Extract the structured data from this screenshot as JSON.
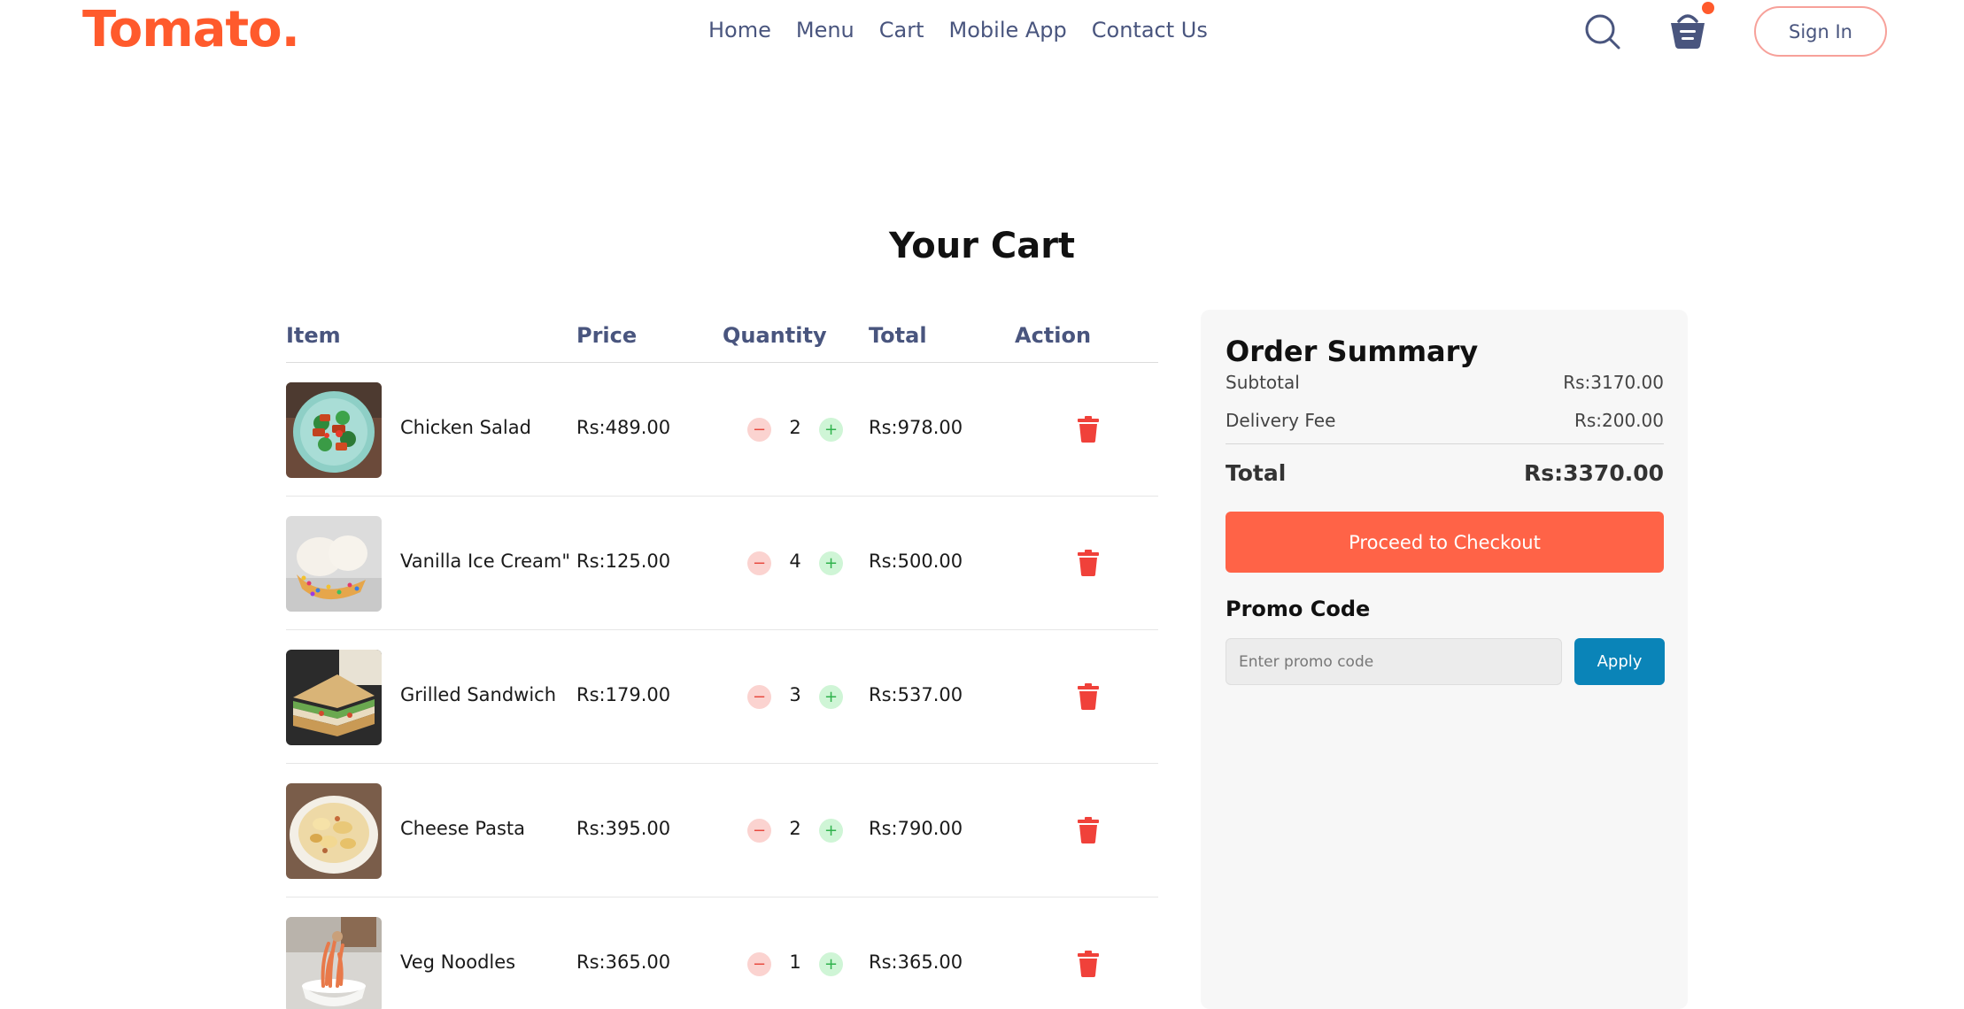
{
  "brand": {
    "logo": "Tomato."
  },
  "nav": {
    "links": [
      "Home",
      "Menu",
      "Cart",
      "Mobile App",
      "Contact Us"
    ],
    "signin_label": "Sign In",
    "icons": [
      "search-icon",
      "basket-icon"
    ],
    "cart_has_items": true
  },
  "colors": {
    "accent": "#ff6347",
    "brand": "#ff5a2c",
    "nav_text": "#49557e",
    "apply": "#0a84b8",
    "delete": "#f0413a"
  },
  "page": {
    "title": "Your Cart"
  },
  "table": {
    "headers": [
      "Item",
      "Price",
      "Quantity",
      "Total",
      "Action"
    ],
    "rows": [
      {
        "name": "Chicken Salad",
        "price": "Rs:489.00",
        "qty": "2",
        "total": "Rs:978.00"
      },
      {
        "name": "Vanilla Ice Cream\"",
        "price": "Rs:125.00",
        "qty": "4",
        "total": "Rs:500.00"
      },
      {
        "name": "Grilled Sandwich",
        "price": "Rs:179.00",
        "qty": "3",
        "total": "Rs:537.00"
      },
      {
        "name": "Cheese Pasta",
        "price": "Rs:395.00",
        "qty": "2",
        "total": "Rs:790.00"
      },
      {
        "name": "Veg Noodles",
        "price": "Rs:365.00",
        "qty": "1",
        "total": "Rs:365.00"
      }
    ],
    "minus_symbol": "−",
    "plus_symbol": "+"
  },
  "summary": {
    "title": "Order Summary",
    "subtotal_label": "Subtotal",
    "subtotal_value": "Rs:3170.00",
    "delivery_label": "Delivery Fee",
    "delivery_value": "Rs:200.00",
    "total_label": "Total",
    "total_value": "Rs:3370.00",
    "checkout_label": "Proceed to Checkout",
    "promo_title": "Promo Code",
    "promo_placeholder": "Enter promo code",
    "apply_label": "Apply"
  }
}
